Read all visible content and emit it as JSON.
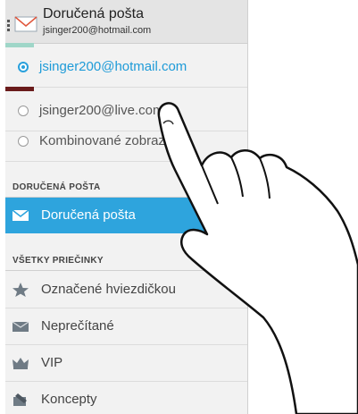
{
  "header": {
    "title": "Doručená pošta",
    "subtitle": "jsinger200@hotmail.com"
  },
  "accounts": [
    {
      "label": "jsinger200@hotmail.com",
      "selected": true,
      "strip_color": "#9fd6c8"
    },
    {
      "label": "jsinger200@live.com",
      "selected": false,
      "strip_color": "#6a1b1b"
    },
    {
      "label": "Kombinované zobrazenie",
      "selected": false
    }
  ],
  "sections": {
    "inbox_header": "DORUČENÁ POŠTA",
    "all_folders_header": "VŠETKY PRIEČINKY"
  },
  "inbox_item": {
    "label": "Doručená pošta",
    "icon": "envelope-icon"
  },
  "folders": [
    {
      "label": "Označené hviezdičkou",
      "icon": "star-icon"
    },
    {
      "label": "Neprečítané",
      "icon": "unread-envelope-icon"
    },
    {
      "label": "VIP",
      "icon": "crown-icon"
    },
    {
      "label": "Koncepty",
      "icon": "drafts-icon"
    }
  ],
  "colors": {
    "accent": "#2ea4dd",
    "selected_text": "#1e9bd8"
  }
}
